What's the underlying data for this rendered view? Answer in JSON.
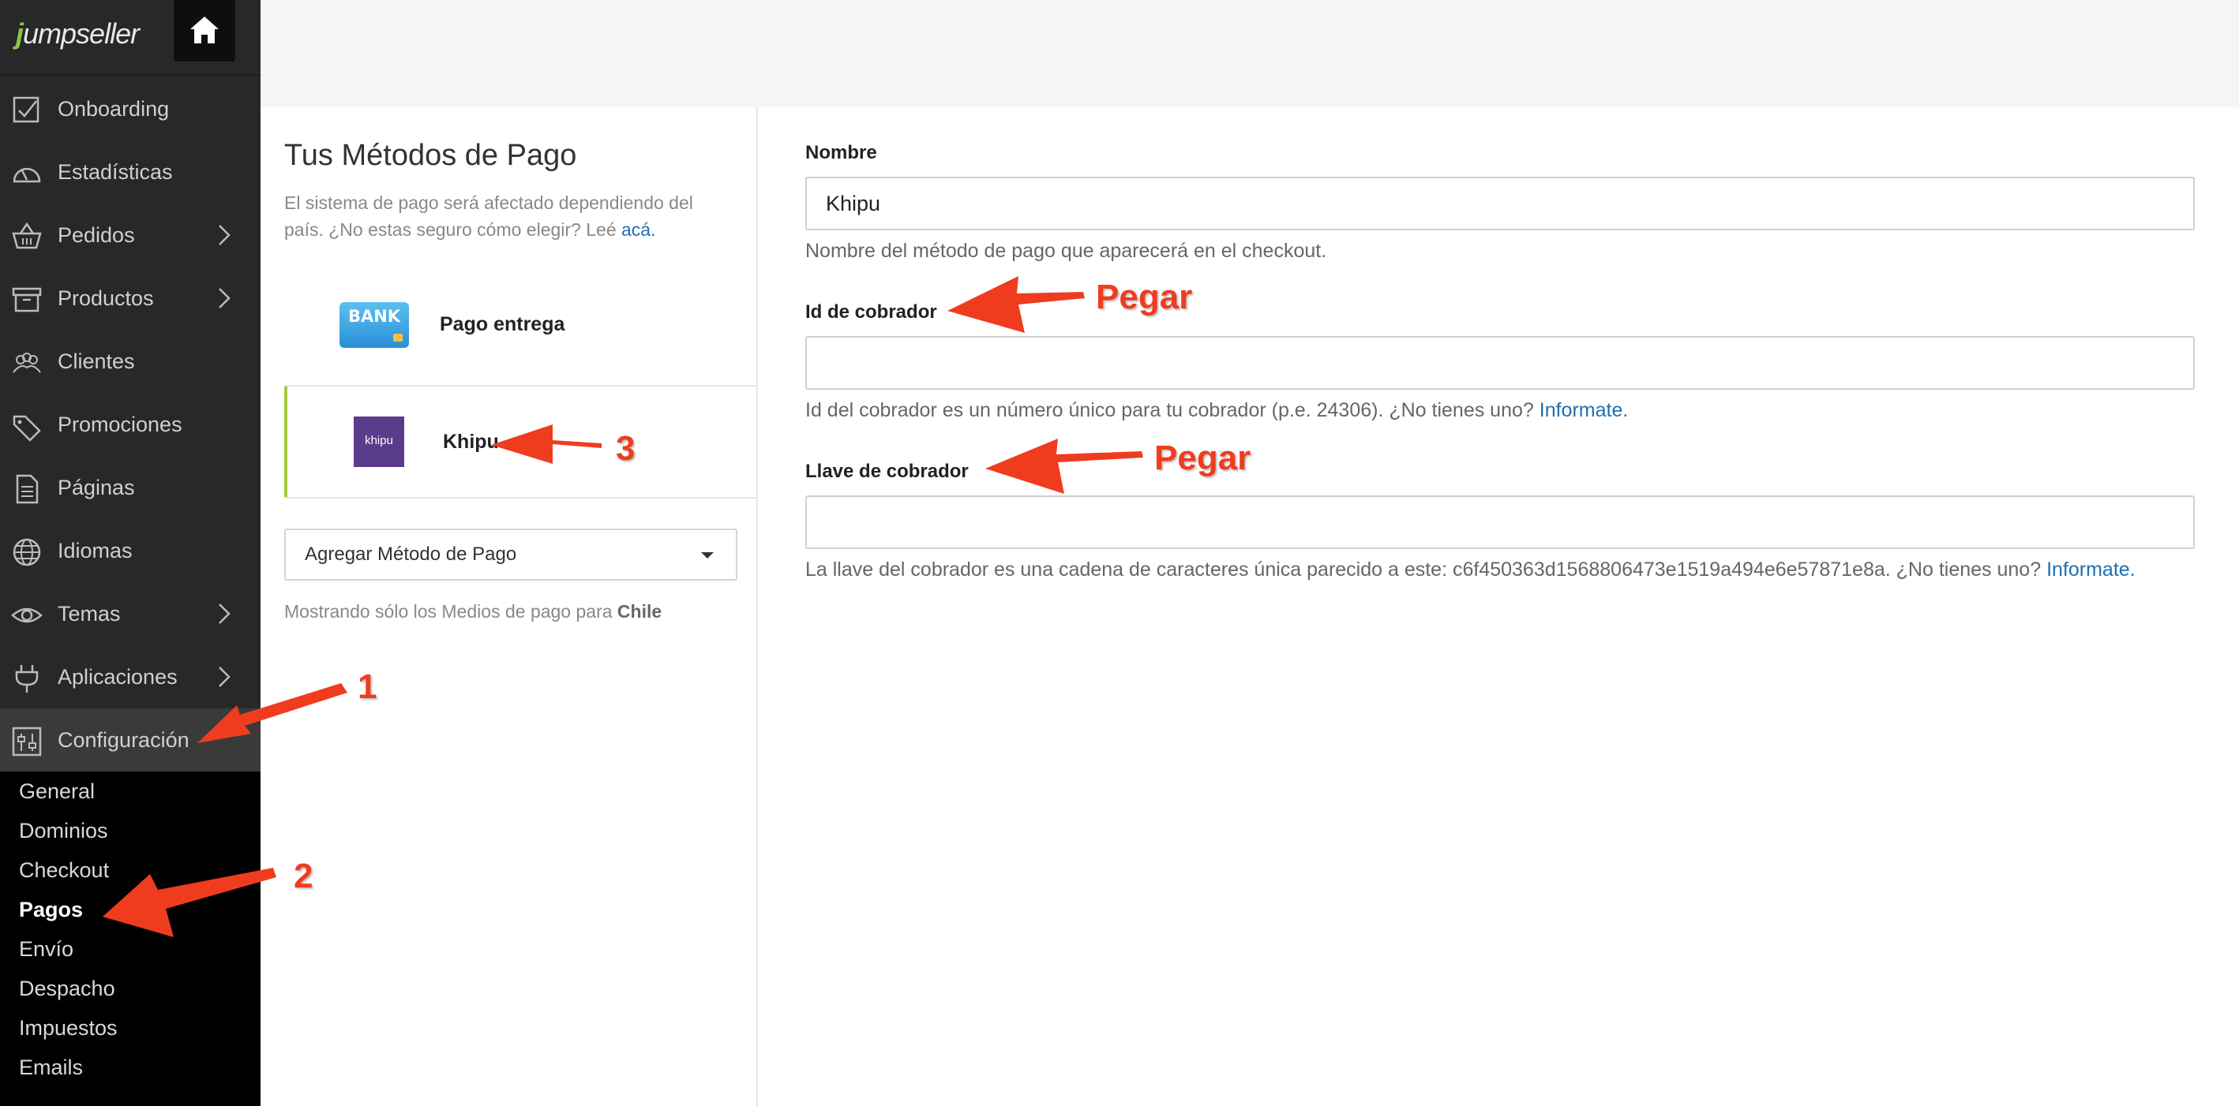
{
  "brand": {
    "logo_first": "j",
    "logo_rest": "umpseller",
    "home_icon": "home-icon"
  },
  "sidebar": {
    "items": [
      {
        "label": "Onboarding",
        "icon": "checkbox-icon"
      },
      {
        "label": "Estadísticas",
        "icon": "gauge-icon"
      },
      {
        "label": "Pedidos",
        "icon": "basket-icon"
      },
      {
        "label": "Productos",
        "icon": "archive-icon"
      },
      {
        "label": "Clientes",
        "icon": "users-icon"
      },
      {
        "label": "Promociones",
        "icon": "tag-icon"
      },
      {
        "label": "Páginas",
        "icon": "document-icon"
      },
      {
        "label": "Idiomas",
        "icon": "globe-icon"
      },
      {
        "label": "Temas",
        "icon": "eye-icon"
      },
      {
        "label": "Aplicaciones",
        "icon": "plug-icon"
      },
      {
        "label": "Configuración",
        "icon": "settings-sliders-icon"
      }
    ],
    "sub_items": [
      "General",
      "Dominios",
      "Checkout",
      "Pagos",
      "Envío",
      "Despacho",
      "Impuestos",
      "Emails"
    ]
  },
  "payments": {
    "title": "Tus Métodos de Pago",
    "description": "El sistema de pago será afectado dependiendo del país. ¿No estas seguro cómo elegir? Leé",
    "description_link": "acá.",
    "methods": [
      {
        "name": "Pago entrega",
        "logo_text": "BANK"
      },
      {
        "name": "Khipu",
        "logo_text": "khipu"
      }
    ],
    "add_method": "Agregar Método de Pago",
    "showing_prefix": "Mostrando sólo los Medios de pago para",
    "showing_country": "Chile"
  },
  "form": {
    "name_label": "Nombre",
    "name_value": "Khipu",
    "name_help": "Nombre del método de pago que aparecerá en el checkout.",
    "id_label": "Id de cobrador",
    "id_value": "",
    "id_help": "Id del cobrador es un número único para tu cobrador (p.e. 24306). ¿No tienes uno?",
    "id_help_link": "Informate.",
    "key_label": "Llave de cobrador",
    "key_value": "",
    "key_help": "La llave del cobrador es una cadena de caracteres única parecido a este: c6f450363d1568806473e1519a494e6e57871e8a. ¿No tienes uno?",
    "key_help_link": "Informate."
  },
  "annotations": {
    "paste_1": "Pegar",
    "paste_2": "Pegar",
    "step_1": "1",
    "step_2": "2",
    "step_3": "3",
    "color": "#f03c1e"
  },
  "colors": {
    "sidebar_bg": "#282828",
    "accent_green": "#a6c93a",
    "link_blue": "#1f6fb2"
  }
}
